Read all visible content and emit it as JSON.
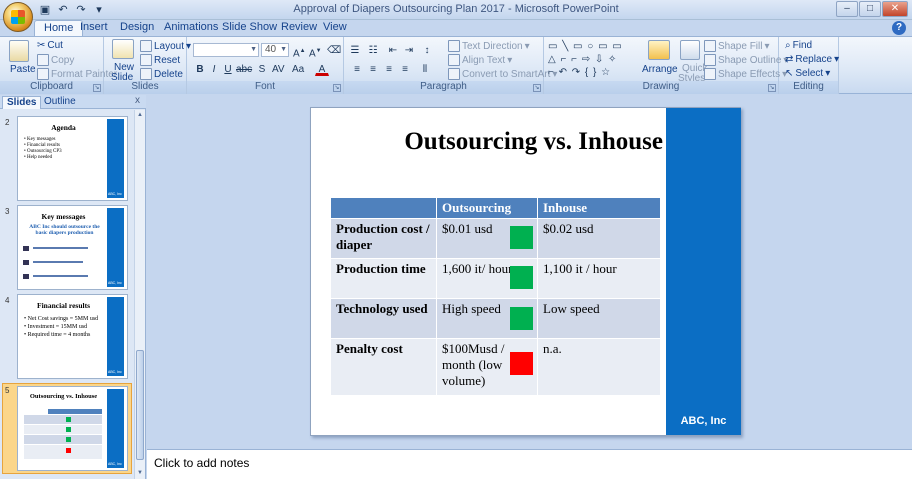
{
  "window": {
    "title": "Approval of Diapers Outsourcing Plan 2017 - Microsoft PowerPoint",
    "minimize": "–",
    "maximize": "□",
    "close": "✕"
  },
  "tabs": [
    "Home",
    "Insert",
    "Design",
    "Animations",
    "Slide Show",
    "Review",
    "View"
  ],
  "ribbon": {
    "clipboard": {
      "label": "Clipboard",
      "paste": "Paste",
      "cut": "Cut",
      "copy": "Copy",
      "format_painter": "Format Painter"
    },
    "slides": {
      "label": "Slides",
      "new_slide": "New",
      "new_slide2": "Slide",
      "layout": "Layout",
      "reset": "Reset",
      "delete": "Delete"
    },
    "font": {
      "label": "Font",
      "font_name": "",
      "font_size": "40"
    },
    "paragraph": {
      "label": "Paragraph",
      "text_direction": "Text Direction",
      "align_text": "Align Text",
      "convert_smartart": "Convert to SmartArt"
    },
    "drawing": {
      "label": "Drawing",
      "arrange": "Arrange",
      "quick_styles": "Quick",
      "quick_styles2": "Styles",
      "shape_fill": "Shape Fill",
      "shape_outline": "Shape Outline",
      "shape_effects": "Shape Effects"
    },
    "editing": {
      "label": "Editing",
      "find": "Find",
      "replace": "Replace",
      "select": "Select"
    }
  },
  "left_panel": {
    "tab_slides": "Slides",
    "tab_outline": "Outline",
    "close": "x",
    "thumbnails": [
      {
        "num": "2",
        "title": "Agenda",
        "lines": [
          "Key messages",
          "Financial results",
          "Outsourcing CP3",
          "Help needed"
        ],
        "brand": "ABC, Inc"
      },
      {
        "num": "3",
        "title": "Key messages",
        "lines": [
          "ABC Inc should outsource the basic diapers production"
        ],
        "brand": "ABC, Inc"
      },
      {
        "num": "4",
        "title": "Financial results",
        "lines": [
          "Net Cost savings = 5MM usd",
          "Investment = 15MM usd",
          "Required time = 4 months"
        ],
        "brand": "ABC, Inc"
      },
      {
        "num": "5",
        "title": "Outsourcing vs. Inhouse",
        "lines": [],
        "brand": "ABC, Inc"
      }
    ]
  },
  "slide": {
    "title": "Outsourcing vs. Inhouse",
    "brand": "ABC, Inc",
    "table": {
      "headers": [
        "",
        "Outsourcing",
        "Inhouse"
      ],
      "rows": [
        {
          "label": "Production cost / diaper",
          "outsourcing": "$0.01 usd",
          "inhouse": "$0.02 usd",
          "indicator": "#00b050"
        },
        {
          "label": "Production time",
          "outsourcing": "1,600 it/ hour",
          "inhouse": "1,100 it / hour",
          "indicator": "#00b050"
        },
        {
          "label": "Technology used",
          "outsourcing": "High speed",
          "inhouse": "Low speed",
          "indicator": "#00b050"
        },
        {
          "label": "Penalty cost",
          "outsourcing": "$100Musd / month (low volume)",
          "inhouse": "n.a.",
          "indicator": "#ff0000"
        }
      ]
    }
  },
  "notes": {
    "placeholder": "Click to add notes"
  }
}
